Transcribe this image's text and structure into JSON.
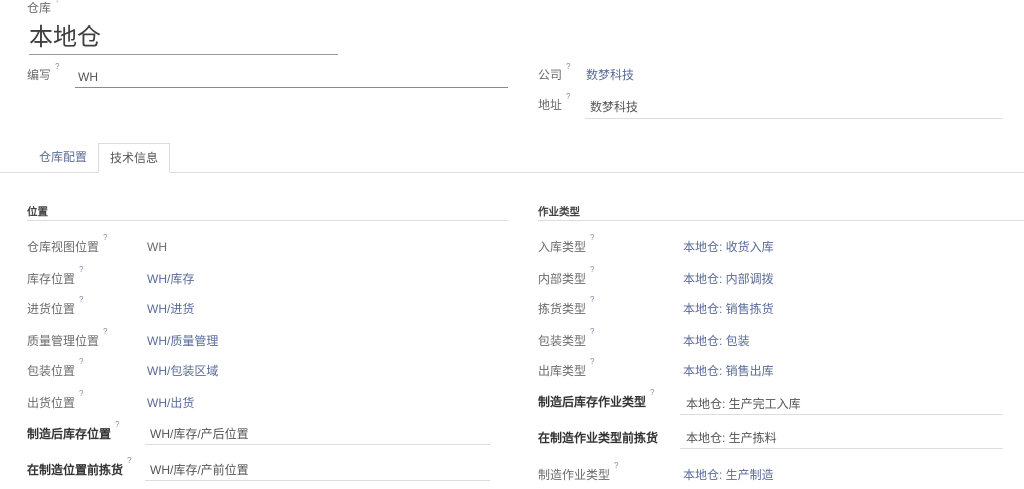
{
  "help_marker": "?",
  "warehouse": {
    "label": "仓库",
    "name": "本地仓"
  },
  "code": {
    "label": "编写",
    "value": "WH"
  },
  "company": {
    "label": "公司",
    "value": "数梦科技"
  },
  "address": {
    "label": "地址",
    "value": "数梦科技"
  },
  "tabs": [
    {
      "label": "仓库配置",
      "active": false
    },
    {
      "label": "技术信息",
      "active": true
    }
  ],
  "locations": {
    "title": "位置",
    "rows": [
      {
        "label": "仓库视图位置",
        "value": "WH"
      },
      {
        "label": "库存位置",
        "value": "WH/库存"
      },
      {
        "label": "进货位置",
        "value": "WH/进货"
      },
      {
        "label": "质量管理位置",
        "value": "WH/质量管理"
      },
      {
        "label": "包装位置",
        "value": "WH/包装区域"
      },
      {
        "label": "出货位置",
        "value": "WH/出货"
      },
      {
        "label": "制造后库存位置",
        "value": "WH/库存/产后位置"
      },
      {
        "label": "在制造位置前拣货",
        "value": "WH/库存/产前位置"
      }
    ]
  },
  "operation_types": {
    "title": "作业类型",
    "rows": [
      {
        "label": "入库类型",
        "value": "本地仓: 收货入库"
      },
      {
        "label": "内部类型",
        "value": "本地仓: 内部调拨"
      },
      {
        "label": "拣货类型",
        "value": "本地仓: 销售拣货"
      },
      {
        "label": "包装类型",
        "value": "本地仓: 包装"
      },
      {
        "label": "出库类型",
        "value": "本地仓: 销售出库"
      },
      {
        "label": "制造后库存作业类型",
        "value": "本地仓: 生产完工入库"
      },
      {
        "label": "在制造作业类型前拣货",
        "value": "本地仓: 生产拣料"
      },
      {
        "label": "制造作业类型",
        "value": "本地仓: 生产制造"
      }
    ]
  },
  "colors": {
    "link": "#5a6b99",
    "label": "#6b6b6b",
    "required_label": "#333333",
    "border": "#dddddd"
  }
}
